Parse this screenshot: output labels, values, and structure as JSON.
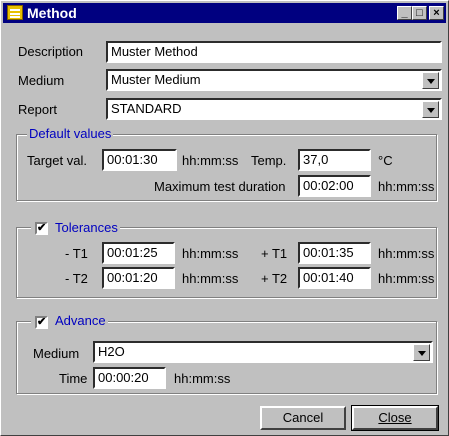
{
  "window": {
    "title": "Method"
  },
  "description": {
    "label": "Description",
    "value": "Muster Method"
  },
  "medium": {
    "label": "Medium",
    "value": "Muster Medium"
  },
  "report": {
    "label": "Report",
    "value": "STANDARD"
  },
  "default_values": {
    "title": "Default values",
    "target_label": "Target val.",
    "target_value": "00:01:30",
    "target_unit": "hh:mm:ss",
    "temp_label": "Temp.",
    "temp_value": "37,0",
    "temp_unit": "°C",
    "max_label": "Maximum test duration",
    "max_value": "00:02:00",
    "max_unit": "hh:mm:ss"
  },
  "tolerances": {
    "title": "Tolerances",
    "checked": true,
    "t1_minus_label": "- T1",
    "t1_minus_value": "00:01:25",
    "t1_plus_label": "+ T1",
    "t1_plus_value": "00:01:35",
    "t2_minus_label": "- T2",
    "t2_minus_value": "00:01:20",
    "t2_plus_label": "+ T2",
    "t2_plus_value": "00:01:40",
    "unit": "hh:mm:ss"
  },
  "advance": {
    "title": "Advance",
    "checked": true,
    "medium_label": "Medium",
    "medium_value": "H2O",
    "time_label": "Time",
    "time_value": "00:00:20",
    "time_unit": "hh:mm:ss"
  },
  "buttons": {
    "cancel": "Cancel",
    "close": "Close"
  },
  "colors": {
    "titlebar": "#000080",
    "group_title": "#0000c0",
    "face": "#c0c0c0"
  }
}
